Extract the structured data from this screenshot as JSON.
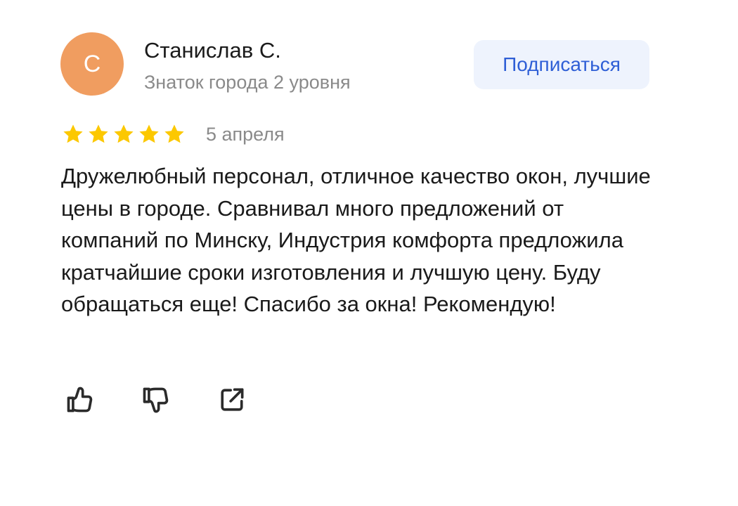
{
  "author": {
    "initial": "С",
    "name": "Станислав С.",
    "level": "Знаток города 2 уровня",
    "avatar_color": "#f09d60"
  },
  "subscribe": {
    "label": "Подписаться",
    "bg_color": "#eef3fd",
    "text_color": "#2f5fd6"
  },
  "rating": {
    "value": 5,
    "max": 5,
    "star_color": "#fcc800"
  },
  "date": "5 апреля",
  "text": "Дружелюбный персонал, отличное качество окон, лучшие цены в городе. Сравнивал много предложений от компаний по Минску, Индустрия комфорта предложила кратчайшие сроки изготовления и лучшую цену. Буду обращаться еще! Спасибо за окна! Рекомендую!",
  "actions": [
    {
      "icon": "thumbs-up-icon"
    },
    {
      "icon": "thumbs-down-icon"
    },
    {
      "icon": "share-icon"
    }
  ]
}
